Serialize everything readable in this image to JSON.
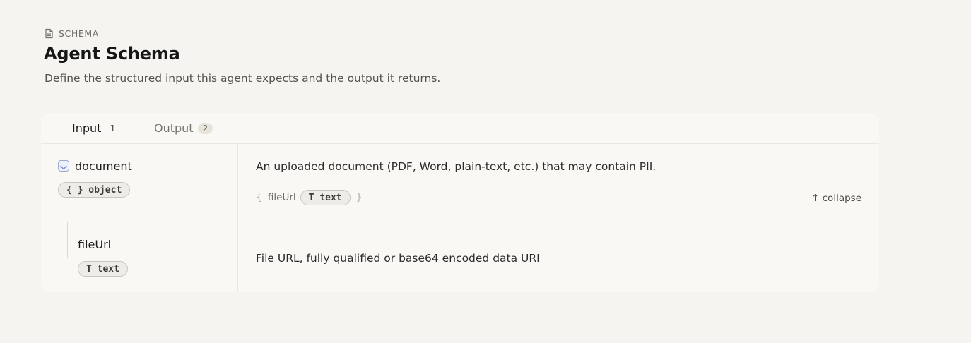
{
  "header": {
    "eyebrow": "SCHEMA",
    "eyebrow_icon": "document-icon",
    "title": "Agent Schema",
    "subtitle": "Define the structured input this agent expects and the output it returns."
  },
  "tabs": [
    {
      "label": "Input",
      "count": "1",
      "active": true
    },
    {
      "label": "Output",
      "count": "2",
      "active": false
    }
  ],
  "fields": [
    {
      "name": "document",
      "type_label": "{ } object",
      "description": "An uploaded document (PDF, Word, plain-text, etc.) that may contain PII.",
      "inline_open_brace": "{",
      "inline_key": "fileUrl",
      "inline_type": "T text",
      "inline_close_brace": "}",
      "collapse_label": "↑ collapse",
      "expanded": true
    },
    {
      "name": "fileUrl",
      "type_label": "T text",
      "description": "File URL, fully qualified or base64 encoded data URI"
    }
  ],
  "colors": {
    "background": "#f5f4f1",
    "card": "#f9f8f5",
    "toggle_border": "#9aaad0"
  }
}
